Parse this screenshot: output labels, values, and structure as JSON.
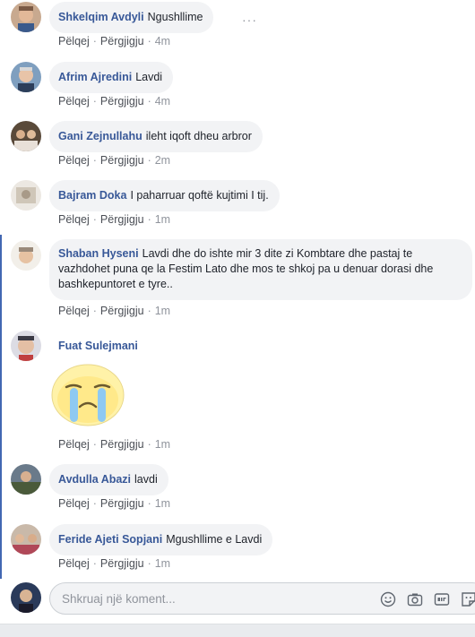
{
  "actions": {
    "like": "Pëlqej",
    "reply": "Përgjigju",
    "separator": "·"
  },
  "comments": [
    {
      "author": "Shkelqim Avdyli",
      "text": "Ngushllime",
      "time": "4m"
    },
    {
      "author": "Afrim Ajredini",
      "text": "Lavdi",
      "time": "4m"
    },
    {
      "author": "Gani Zejnullahu",
      "text": "ileht iqoft dheu arbror",
      "time": "2m"
    },
    {
      "author": "Bajram Doka",
      "text": "I paharruar qoftë kujtimi I tij.",
      "time": "1m"
    },
    {
      "author": "Shaban Hyseni",
      "text": "Lavdi dhe do ishte mir 3 dite zi Kombtare dhe pastaj te vazhdohet puna qe la Festim Lato dhe mos te shkoj pa u denuar dorasi dhe bashkepuntoret e tyre..",
      "time": "1m"
    },
    {
      "author": "Fuat Sulejmani",
      "text": "",
      "time": "1m"
    },
    {
      "author": "Avdulla Abazi",
      "text": "lavdi",
      "time": "1m"
    },
    {
      "author": "Feride Ajeti Sopjani",
      "text": "Mgushllime e Lavdi",
      "time": "1m"
    }
  ],
  "more_menu": "···",
  "composer": {
    "placeholder": "Shkruaj një koment..."
  },
  "colors": {
    "author": "#385898",
    "bubble": "#f2f3f5",
    "accent": "#4267b2",
    "meta": "#90949c"
  },
  "icons": [
    "more-options-icon",
    "crying-sticker",
    "emoji-icon",
    "camera-icon",
    "gif-icon",
    "sticker-icon"
  ]
}
